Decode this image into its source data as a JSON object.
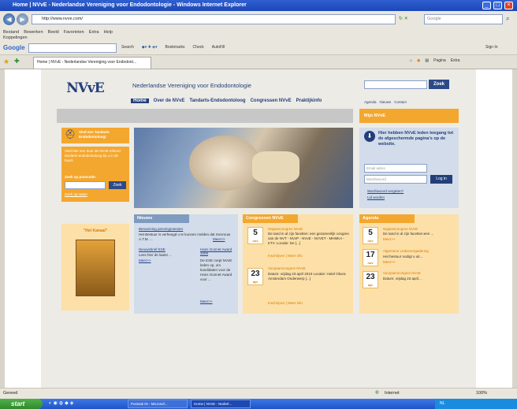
{
  "window": {
    "title": "Home | NVvE - Nederlandse Vereniging voor Endodontologie - Windows Internet Explorer"
  },
  "address": {
    "url": "http://www.nvve.com/",
    "search_placeholder": "Google"
  },
  "menu": [
    "Bestand",
    "Bewerken",
    "Beeld",
    "Favorieten",
    "Extra",
    "Help"
  ],
  "links_label": "Koppelingen",
  "google_toolbar": {
    "label": "Google",
    "search": "Search",
    "bookmarks": "Bookmarks",
    "check": "Check",
    "autofill": "AutoFill",
    "signin": "Sign In"
  },
  "tab": {
    "title": "Home | NVvE - Nederlandse Vereniging voor Endodont..."
  },
  "tab_tools": {
    "pagina": "Pagina",
    "extra": "Extra"
  },
  "site": {
    "title": "Nederlandse Vereniging voor Endodontologie",
    "logo": "NVvE",
    "search_button": "Zoek",
    "nav": [
      "Home",
      "Over de NVvE",
      "Tandarts-Endodontoloog",
      "Congressen NVvE",
      "Praktijkinfo"
    ],
    "top_links": [
      "Agenda",
      "Nieuws",
      "Contact"
    ],
    "mijn": "Mijn NVvE",
    "find_tandarts": {
      "title": "Vind een Tandarts Endodontoloog!",
      "text": "Vind hier een door de NVvE erkend tandarts-endodontoloog bij u in de buurt.",
      "postcode_label": "Zoek op postcode:",
      "button": "Zoek",
      "link": "Zoek op naam"
    },
    "login": {
      "title": "Hier hebben NVvE leden toegang tot de afgeschermde pagina's op de website.",
      "email": "Email adres",
      "password": "Wachtwoord",
      "button": "Log in",
      "forgot": "Wachtwoord vergeten?",
      "join": "Lid worden"
    },
    "het_kanaal": "\"Het Kanaal\"",
    "nieuws": {
      "header": "Nieuws",
      "item1_title": "Benoeming penningmeester",
      "item1_text": "Het Bestuur is verheugd u te kunnen melden dat mevrouw A.T.M. ...",
      "item1_more": "Meer>>",
      "item2_title": "Nieuwsbrief ESE",
      "item2_text": "Lees hier de laatst ...",
      "item2_more": "Meer>>",
      "item3_title": "Hans Gonnet Award 2009",
      "item3_text": "De ESE roept NVvE leden op, om kandidaten voor de Hans Gonnet Award voor ...",
      "item3_more": "Meer>>"
    },
    "congressen": {
      "header": "Congressen NVvE",
      "items": [
        {
          "day": "5",
          "month": "nov",
          "title": "Najaarscongres NVvE",
          "text": "De tand in al zijn facetten: een gezamenlijk congres van de NVT - NVvP - NVvE - NVVET - MHMKA - KTV. Locatie: De [...]",
          "links": "Inschrijven | Meer info"
        },
        {
          "day": "23",
          "month": "apr",
          "title": "Voorjaarscongres NVvE",
          "text": "Datum: vrijdag 23 april 2010 Locatie: Hotel Okura Amsterdam Onderwerp [...]",
          "links": "Inschrijven | Meer info"
        }
      ]
    },
    "agenda": {
      "header": "Agenda",
      "items": [
        {
          "day": "5",
          "month": "nov",
          "title": "Najaarscongres NVvE",
          "text": "De tand in al zijn facetten:een ...",
          "more": "Meer>>"
        },
        {
          "day": "17",
          "month": "nov",
          "title": "Algemene Ledenvergadering",
          "text": "Het bestuur nodigt u uit...",
          "more": "Meer>>"
        },
        {
          "day": "23",
          "month": "apr",
          "title": "Voorjaarscongres NVvE",
          "text": "Datum: vrijdag 23 april...",
          "more": "Meer>>"
        }
      ]
    }
  },
  "status": {
    "left": "Gereed",
    "zone": "Internet",
    "zoom": "100%"
  },
  "taskbar": {
    "start": "start",
    "items": [
      "Postvak IN - Microsof...",
      "Home | NVvE - Nederl..."
    ],
    "tray": "NL"
  }
}
